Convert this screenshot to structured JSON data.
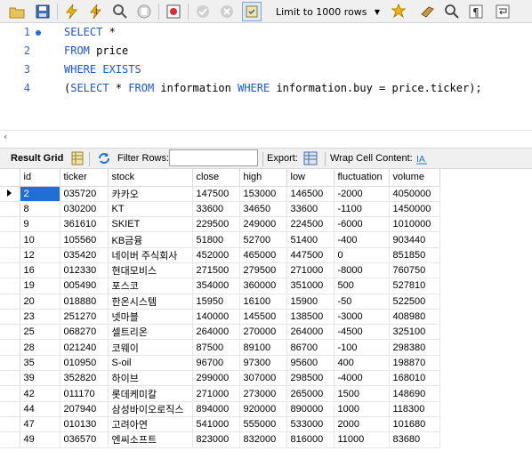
{
  "toolbar": {
    "limit_label": "Limit to 1000 rows",
    "buttons": [
      "open-folder-icon",
      "save-icon",
      "execute-icon",
      "execute-current-icon",
      "explain-icon",
      "stop-icon",
      "toggle-errors-icon",
      "commit-icon",
      "rollback-icon",
      "autocommit-icon",
      "limit-select",
      "beautify-icon",
      "find-icon",
      "invisible-chars-icon",
      "wrap-icon"
    ]
  },
  "editor": {
    "lines": [
      {
        "num": "1",
        "dot": true,
        "tokens": [
          {
            "t": "SELECT",
            "k": true
          },
          {
            "t": " *",
            "k": false
          }
        ]
      },
      {
        "num": "2",
        "dot": false,
        "tokens": [
          {
            "t": "FROM",
            "k": true
          },
          {
            "t": " price",
            "k": false
          }
        ]
      },
      {
        "num": "3",
        "dot": false,
        "tokens": [
          {
            "t": "WHERE EXISTS",
            "k": true
          }
        ]
      },
      {
        "num": "4",
        "dot": false,
        "tokens": [
          {
            "t": "(",
            "k": false
          },
          {
            "t": "SELECT",
            "k": true
          },
          {
            "t": " * ",
            "k": false
          },
          {
            "t": "FROM",
            "k": true
          },
          {
            "t": " information ",
            "k": false
          },
          {
            "t": "WHERE",
            "k": true
          },
          {
            "t": " information.buy = price.ticker);",
            "k": false
          }
        ]
      }
    ]
  },
  "result_toolbar": {
    "result_grid_label": "Result Grid",
    "filter_rows_label": "Filter Rows:",
    "filter_value": "",
    "export_label": "Export:",
    "wrap_label": "Wrap Cell Content:"
  },
  "grid": {
    "columns": [
      "id",
      "ticker",
      "stock",
      "close",
      "high",
      "low",
      "fluctuation",
      "volume"
    ],
    "rows": [
      [
        "2",
        "035720",
        "카카오",
        "147500",
        "153000",
        "146500",
        "-2000",
        "4050000"
      ],
      [
        "8",
        "030200",
        "KT",
        "33600",
        "34650",
        "33600",
        "-1100",
        "1450000"
      ],
      [
        "9",
        "361610",
        "SKIET",
        "229500",
        "249000",
        "224500",
        "-6000",
        "1010000"
      ],
      [
        "10",
        "105560",
        "KB금융",
        "51800",
        "52700",
        "51400",
        "-400",
        "903440"
      ],
      [
        "12",
        "035420",
        "네이버 주식회사",
        "452000",
        "465000",
        "447500",
        "0",
        "851850"
      ],
      [
        "16",
        "012330",
        "현대모비스",
        "271500",
        "279500",
        "271000",
        "-8000",
        "760750"
      ],
      [
        "19",
        "005490",
        "포스코",
        "354000",
        "360000",
        "351000",
        "500",
        "527810"
      ],
      [
        "20",
        "018880",
        "한온시스템",
        "15950",
        "16100",
        "15900",
        "-50",
        "522500"
      ],
      [
        "23",
        "251270",
        "넷마블",
        "140000",
        "145500",
        "138500",
        "-3000",
        "408980"
      ],
      [
        "25",
        "068270",
        "셀트리온",
        "264000",
        "270000",
        "264000",
        "-4500",
        "325100"
      ],
      [
        "28",
        "021240",
        "코웨이",
        "87500",
        "89100",
        "86700",
        "-100",
        "298380"
      ],
      [
        "35",
        "010950",
        "S-oil",
        "96700",
        "97300",
        "95600",
        "400",
        "198870"
      ],
      [
        "39",
        "352820",
        "하이브",
        "299000",
        "307000",
        "298500",
        "-4000",
        "168010"
      ],
      [
        "42",
        "011170",
        "롯데케미칼",
        "271000",
        "273000",
        "265000",
        "1500",
        "148690"
      ],
      [
        "44",
        "207940",
        "삼성바이오로직스",
        "894000",
        "920000",
        "890000",
        "1000",
        "118300"
      ],
      [
        "47",
        "010130",
        "고려아연",
        "541000",
        "555000",
        "533000",
        "2000",
        "101680"
      ],
      [
        "49",
        "036570",
        "엔씨소프트",
        "823000",
        "832000",
        "816000",
        "11000",
        "83680"
      ]
    ]
  }
}
